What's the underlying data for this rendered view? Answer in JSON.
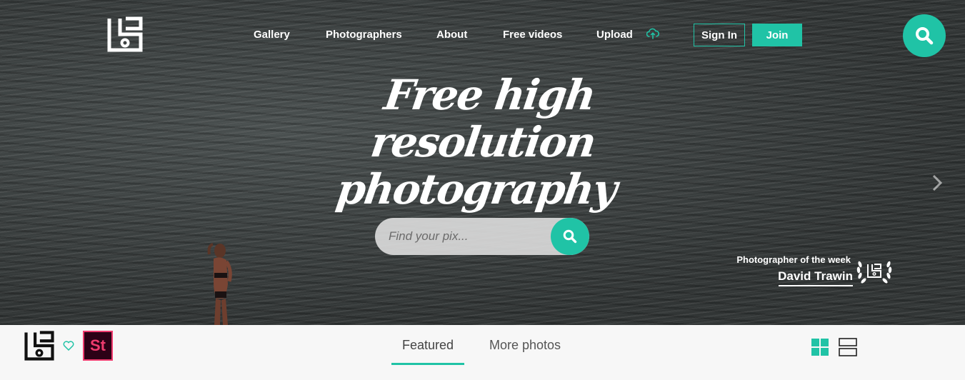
{
  "brand": {
    "logo": "logo-icon",
    "accent": "#20c3a6"
  },
  "nav": {
    "items": [
      {
        "label": "Gallery"
      },
      {
        "label": "Photographers"
      },
      {
        "label": "About"
      },
      {
        "label": "Free videos"
      },
      {
        "label": "Upload",
        "icon": "cloud-upload-icon"
      }
    ],
    "signin_label": "Sign In",
    "join_label": "Join",
    "search_icon": "search-icon"
  },
  "hero": {
    "headline_line1": "Free high resolution",
    "headline_line2": "photography",
    "search_placeholder": "Find your pix...",
    "next_icon": "chevron-right-icon"
  },
  "photographer_of_week": {
    "label": "Photographer of the week",
    "name": "David Trawin",
    "badge_icon": "laurel-wreath-icon"
  },
  "toolbar": {
    "tabs": [
      {
        "label": "Featured",
        "active": true
      },
      {
        "label": "More photos",
        "active": false
      }
    ],
    "stock_label": "St",
    "heart_icon": "heart-icon",
    "grid_icon": "grid-view-icon",
    "list_icon": "list-view-icon"
  }
}
